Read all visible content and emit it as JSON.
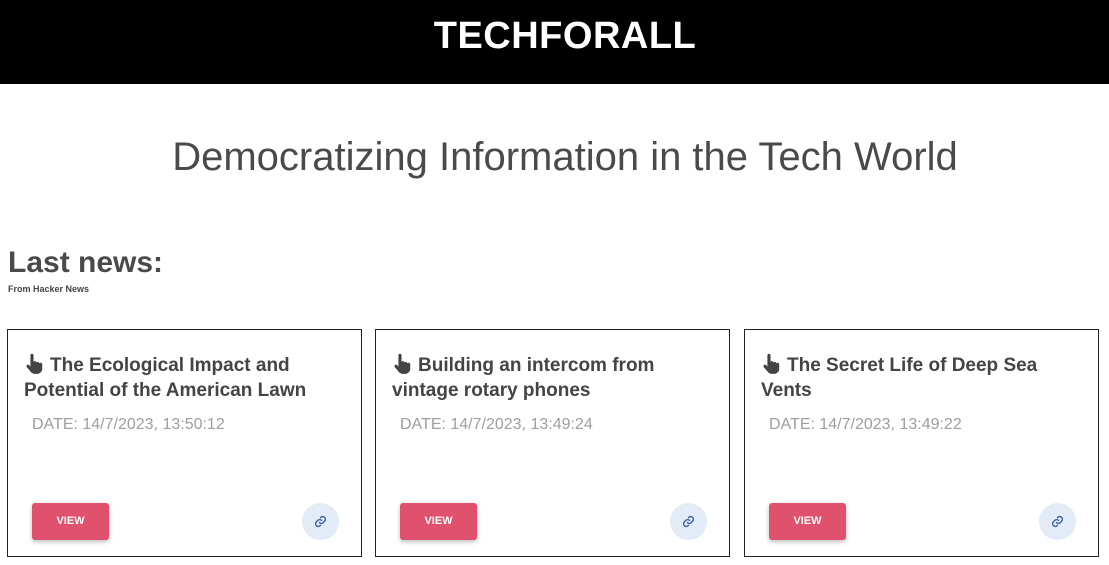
{
  "header": {
    "brand": "TECHFORALL"
  },
  "hero": {
    "tagline": "Democratizing Information in the Tech World"
  },
  "news": {
    "title": "Last news:",
    "source": "From Hacker News",
    "cards": [
      {
        "title": "The Ecological Impact and Potential of the American Lawn",
        "date": "DATE: 14/7/2023, 13:50:12",
        "view_label": "VIEW"
      },
      {
        "title": "Building an intercom from vintage rotary phones",
        "date": "DATE: 14/7/2023, 13:49:24",
        "view_label": "VIEW"
      },
      {
        "title": "The Secret Life of Deep Sea Vents",
        "date": "DATE: 14/7/2023, 13:49:22",
        "view_label": "VIEW"
      }
    ]
  },
  "icons": {
    "card_title": "hand-pointer-icon",
    "link_button": "link-icon"
  },
  "colors": {
    "header_bg": "#000000",
    "view_button": "#e0516e",
    "link_button_bg": "#e3ebf7",
    "link_icon": "#3b5fa0",
    "date_text": "#9e9e9e"
  }
}
